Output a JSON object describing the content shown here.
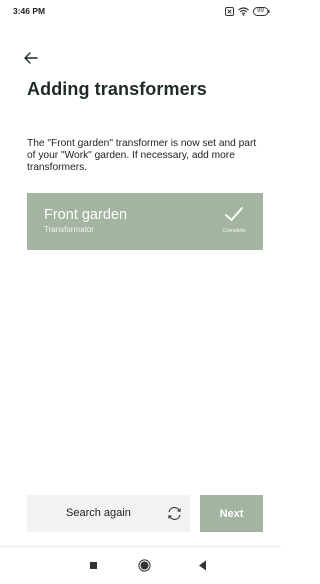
{
  "status_bar": {
    "time": "3:46 PM",
    "battery_level": "99",
    "icons": [
      "close-box-icon",
      "wifi-icon",
      "battery-icon"
    ]
  },
  "header": {
    "back_icon": "arrow-left-icon",
    "title": "Adding transformers"
  },
  "main": {
    "description": "The \"Front garden\" transformer is now set and part of your \"Work\" garden. If necessary, add more transformers.",
    "transformer_card": {
      "name": "Front garden",
      "subtitle": "Transformator",
      "status": "Complete",
      "status_icon": "checkmark-icon",
      "background_color": "#a3b4a0"
    }
  },
  "footer": {
    "search_again_label": "Search again",
    "search_again_icon": "refresh-icon",
    "next_label": "Next",
    "next_color": "#a3b4a0"
  },
  "nav_bar": {
    "icons": [
      "recent-apps-icon",
      "home-icon",
      "back-icon"
    ]
  }
}
